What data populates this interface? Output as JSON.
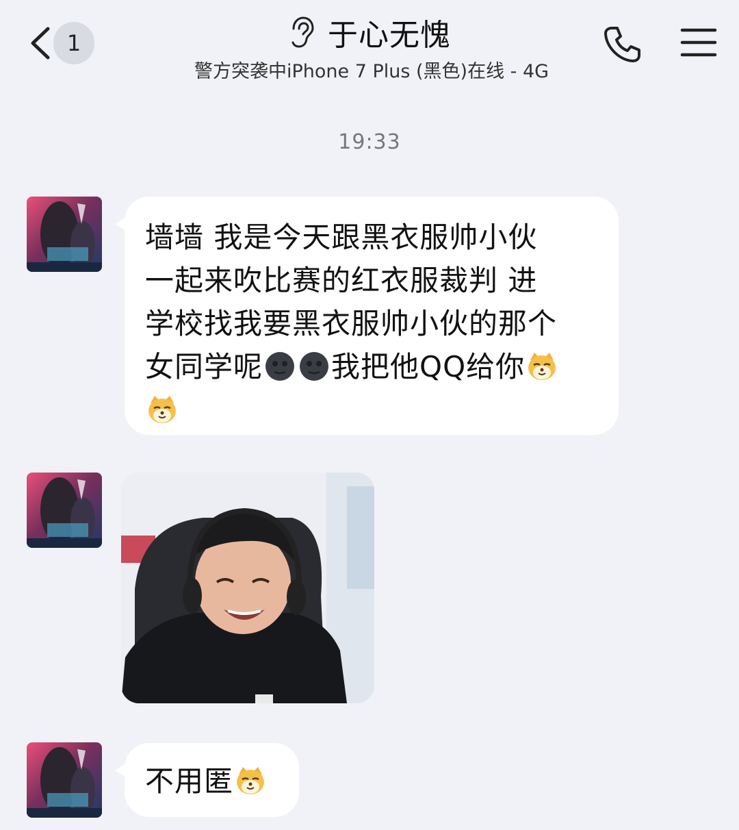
{
  "header": {
    "back_icon": "chevron-left-icon",
    "unread_count": "1",
    "ear_icon": "ear-icon",
    "title": "于心无愧",
    "status": "警方突袭中iPhone 7 Plus (黑色)在线 - 4G",
    "call_icon": "phone-icon",
    "menu_icon": "hamburger-menu-icon"
  },
  "time_divider": "19:33",
  "messages": [
    {
      "type": "text",
      "segments": {
        "a": "墙墙 我是今天跟黑衣服帅小伙\n一起来吹比赛的红衣服裁判 进\n学校找我要黑衣服帅小伙的那个\n女同学呢",
        "b": "我把他QQ给你"
      },
      "emojis": [
        "new-moon-face-emoji",
        "new-moon-face-emoji",
        "smirking-dog-emoji",
        "smirking-dog-emoji"
      ]
    },
    {
      "type": "image",
      "description_icon": "photo-message"
    },
    {
      "type": "text",
      "segments": {
        "a": "不用匿"
      },
      "emojis": [
        "smirking-dog-emoji"
      ]
    }
  ],
  "colors": {
    "background": "#f1f2f7",
    "bubble": "#ffffff",
    "badge": "#d9dbe2",
    "timestamp": "#777777"
  }
}
